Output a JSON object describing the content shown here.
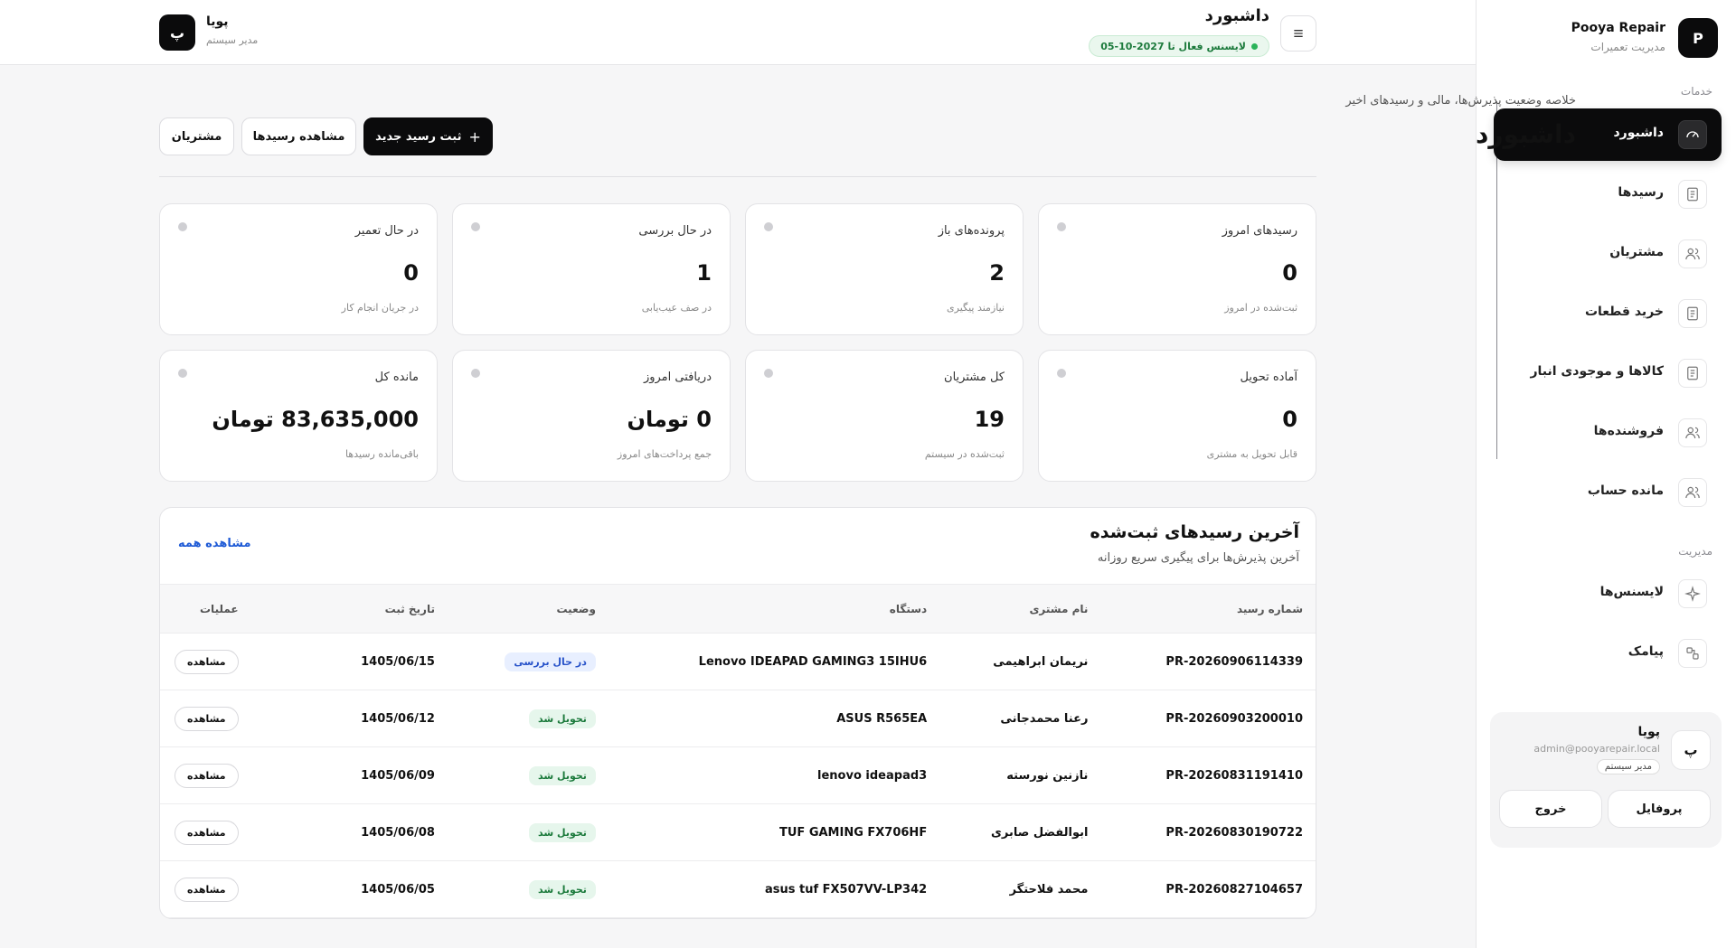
{
  "sidebar": {
    "brand": {
      "logo_letter": "P",
      "name": "Pooya Repair",
      "subtitle": "مدیریت تعمیرات"
    },
    "sections": {
      "services": "خدمات",
      "management": "مدیریت"
    },
    "items": [
      {
        "label": "داشبورد",
        "icon": "gauge-icon",
        "active": true
      },
      {
        "label": "رسیدها",
        "icon": "document-icon"
      },
      {
        "label": "مشتریان",
        "icon": "users-icon"
      },
      {
        "label": "خرید قطعات",
        "icon": "document-icon"
      },
      {
        "label": "کالاها و موجودی انبار",
        "icon": "document-icon"
      },
      {
        "label": "فروشنده‌ها",
        "icon": "users-icon"
      },
      {
        "label": "مانده حساب",
        "icon": "users-icon"
      },
      {
        "label": "لایسنس‌ها",
        "icon": "sparkle-icon"
      },
      {
        "label": "پیامک",
        "icon": "share-icon"
      }
    ],
    "user": {
      "avatar_letter": "پ",
      "name": "پویا",
      "email": "admin@pooyarepair.local",
      "role": "مدیر سیستم",
      "profile_label": "پروفایل",
      "logout_label": "خروج"
    }
  },
  "topbar": {
    "title": "داشبورد",
    "license": "لایسنس فعال تا 2027-10-05",
    "user": {
      "avatar_letter": "پ",
      "name": "پویا",
      "role": "مدیر سیستم"
    }
  },
  "page": {
    "subtitle": "خلاصه وضعیت پذیرش‌ها، مالی و رسیدهای اخیر",
    "title": "داشبورد",
    "actions": {
      "new_receipt": "ثبت رسید جدید",
      "view_receipts": "مشاهده رسیدها",
      "customers": "مشتریان"
    }
  },
  "stats": [
    {
      "label": "رسیدهای امروز",
      "value": "0",
      "hint": "ثبت‌شده در امروز"
    },
    {
      "label": "پرونده‌های باز",
      "value": "2",
      "hint": "نیازمند پیگیری"
    },
    {
      "label": "در حال بررسی",
      "value": "1",
      "hint": "در صف عیب‌یابی"
    },
    {
      "label": "در حال تعمیر",
      "value": "0",
      "hint": "در جریان انجام کار"
    },
    {
      "label": "آماده تحویل",
      "value": "0",
      "hint": "قابل تحویل به مشتری"
    },
    {
      "label": "کل مشتریان",
      "value": "19",
      "hint": "ثبت‌شده در سیستم"
    },
    {
      "label": "دریافتی امروز",
      "value": "0 تومان",
      "hint": "جمع پرداخت‌های امروز"
    },
    {
      "label": "مانده کل",
      "value": "83,635,000 تومان",
      "hint": "باقی‌مانده رسیدها"
    }
  ],
  "recent": {
    "title": "آخرین رسیدهای ثبت‌شده",
    "subtitle": "آخرین پذیرش‌ها برای پیگیری سریع روزانه",
    "view_all": "مشاهده همه",
    "columns": [
      "شماره رسید",
      "نام مشتری",
      "دستگاه",
      "وضعیت",
      "تاریخ ثبت",
      "عملیات"
    ],
    "view_label": "مشاهده",
    "rows": [
      {
        "receipt": "PR-20260906114339",
        "customer": "نریمان ابراهیمی",
        "device": "Lenovo IDEAPAD GAMING3 15IHU6",
        "status": "در حال بررسی",
        "date": "1405/06/15"
      },
      {
        "receipt": "PR-20260903200010",
        "customer": "رعنا محمدجانی",
        "device": "ASUS R565EA",
        "status": "تحویل شد",
        "date": "1405/06/12"
      },
      {
        "receipt": "PR-20260831191410",
        "customer": "نازنین نورسته",
        "device": "lenovo ideapad3",
        "status": "تحویل شد",
        "date": "1405/06/09"
      },
      {
        "receipt": "PR-20260830190722",
        "customer": "ابوالفضل صابری",
        "device": "TUF GAMING FX706HF",
        "status": "تحویل شد",
        "date": "1405/06/08"
      },
      {
        "receipt": "PR-20260827104657",
        "customer": "محمد فلاحتگر",
        "device": "asus tuf FX507VV-LP342",
        "status": "تحویل شد",
        "date": "1405/06/05"
      }
    ]
  }
}
